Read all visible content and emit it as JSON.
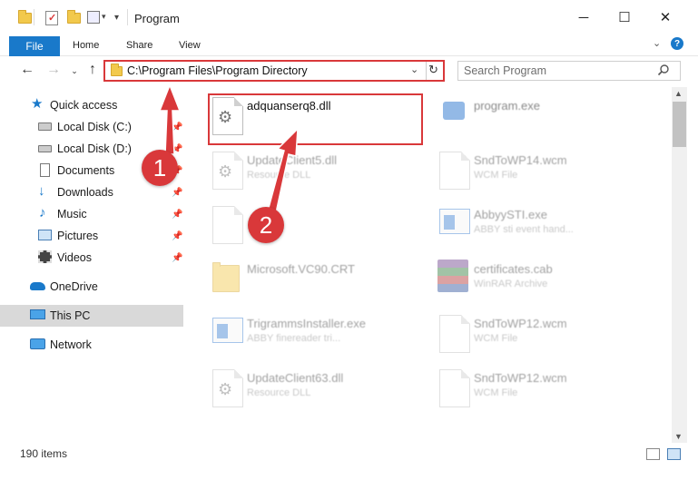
{
  "window": {
    "title": "Program",
    "controls": {
      "minimize": "─",
      "maximize": "☐",
      "close": "✕"
    }
  },
  "ribbon": {
    "tabs": [
      "File",
      "Home",
      "Share",
      "View"
    ],
    "help": "?"
  },
  "nav": {
    "address": "C:\\Program Files\\Program Directory",
    "search_placeholder": "Search Program"
  },
  "sidebar": {
    "items": [
      {
        "label": "Quick access",
        "icon": "star-icon",
        "pinned": false
      },
      {
        "label": "Local Disk (C:)",
        "icon": "drive-icon",
        "pinned": true
      },
      {
        "label": "Local Disk (D:)",
        "icon": "drive-icon",
        "pinned": true
      },
      {
        "label": "Documents",
        "icon": "documents-icon",
        "pinned": true
      },
      {
        "label": "Downloads",
        "icon": "download-icon",
        "pinned": true
      },
      {
        "label": "Music",
        "icon": "music-icon",
        "pinned": true
      },
      {
        "label": "Pictures",
        "icon": "pictures-icon",
        "pinned": true
      },
      {
        "label": "Videos",
        "icon": "videos-icon",
        "pinned": true
      },
      {
        "label": "OneDrive",
        "icon": "cloud-icon",
        "pinned": false
      },
      {
        "label": "This PC",
        "icon": "computer-icon",
        "pinned": false,
        "selected": true
      },
      {
        "label": "Network",
        "icon": "network-icon",
        "pinned": false
      }
    ]
  },
  "files": [
    {
      "name": "adquanserq8.dll",
      "desc": "",
      "icon": "dll-gear-icon",
      "highlighted": true
    },
    {
      "name": "program.exe",
      "desc": "",
      "icon": "exe-icon"
    },
    {
      "name": "UpdateClient5.dll",
      "desc": "Resource DLL",
      "icon": "dll-gear-icon"
    },
    {
      "name": "SndToWP14.wcm",
      "desc": "WCM File",
      "icon": "blank-file-icon"
    },
    {
      "name": "",
      "desc": "",
      "icon": "blank-file-icon"
    },
    {
      "name": "AbbyySTI.exe",
      "desc": "ABBY sti event hand...",
      "icon": "exe-window-icon"
    },
    {
      "name": "Microsoft.VC90.CRT",
      "desc": "",
      "icon": "folder-icon"
    },
    {
      "name": "certificates.cab",
      "desc": "WinRAR Archive",
      "icon": "winrar-icon"
    },
    {
      "name": "TrigrammsInstaller.exe",
      "desc": "ABBY finereader tri...",
      "icon": "exe-window-icon"
    },
    {
      "name": "SndToWP12.wcm",
      "desc": "WCM File",
      "icon": "blank-file-icon"
    },
    {
      "name": "UpdateClient63.dll",
      "desc": "Resource DLL",
      "icon": "dll-gear-icon"
    },
    {
      "name": "SndToWP12.wcm",
      "desc": "WCM File",
      "icon": "blank-file-icon"
    }
  ],
  "status": {
    "item_count": "190 items"
  },
  "annotations": {
    "step1": "1",
    "step2": "2",
    "color": "#d9383a"
  }
}
